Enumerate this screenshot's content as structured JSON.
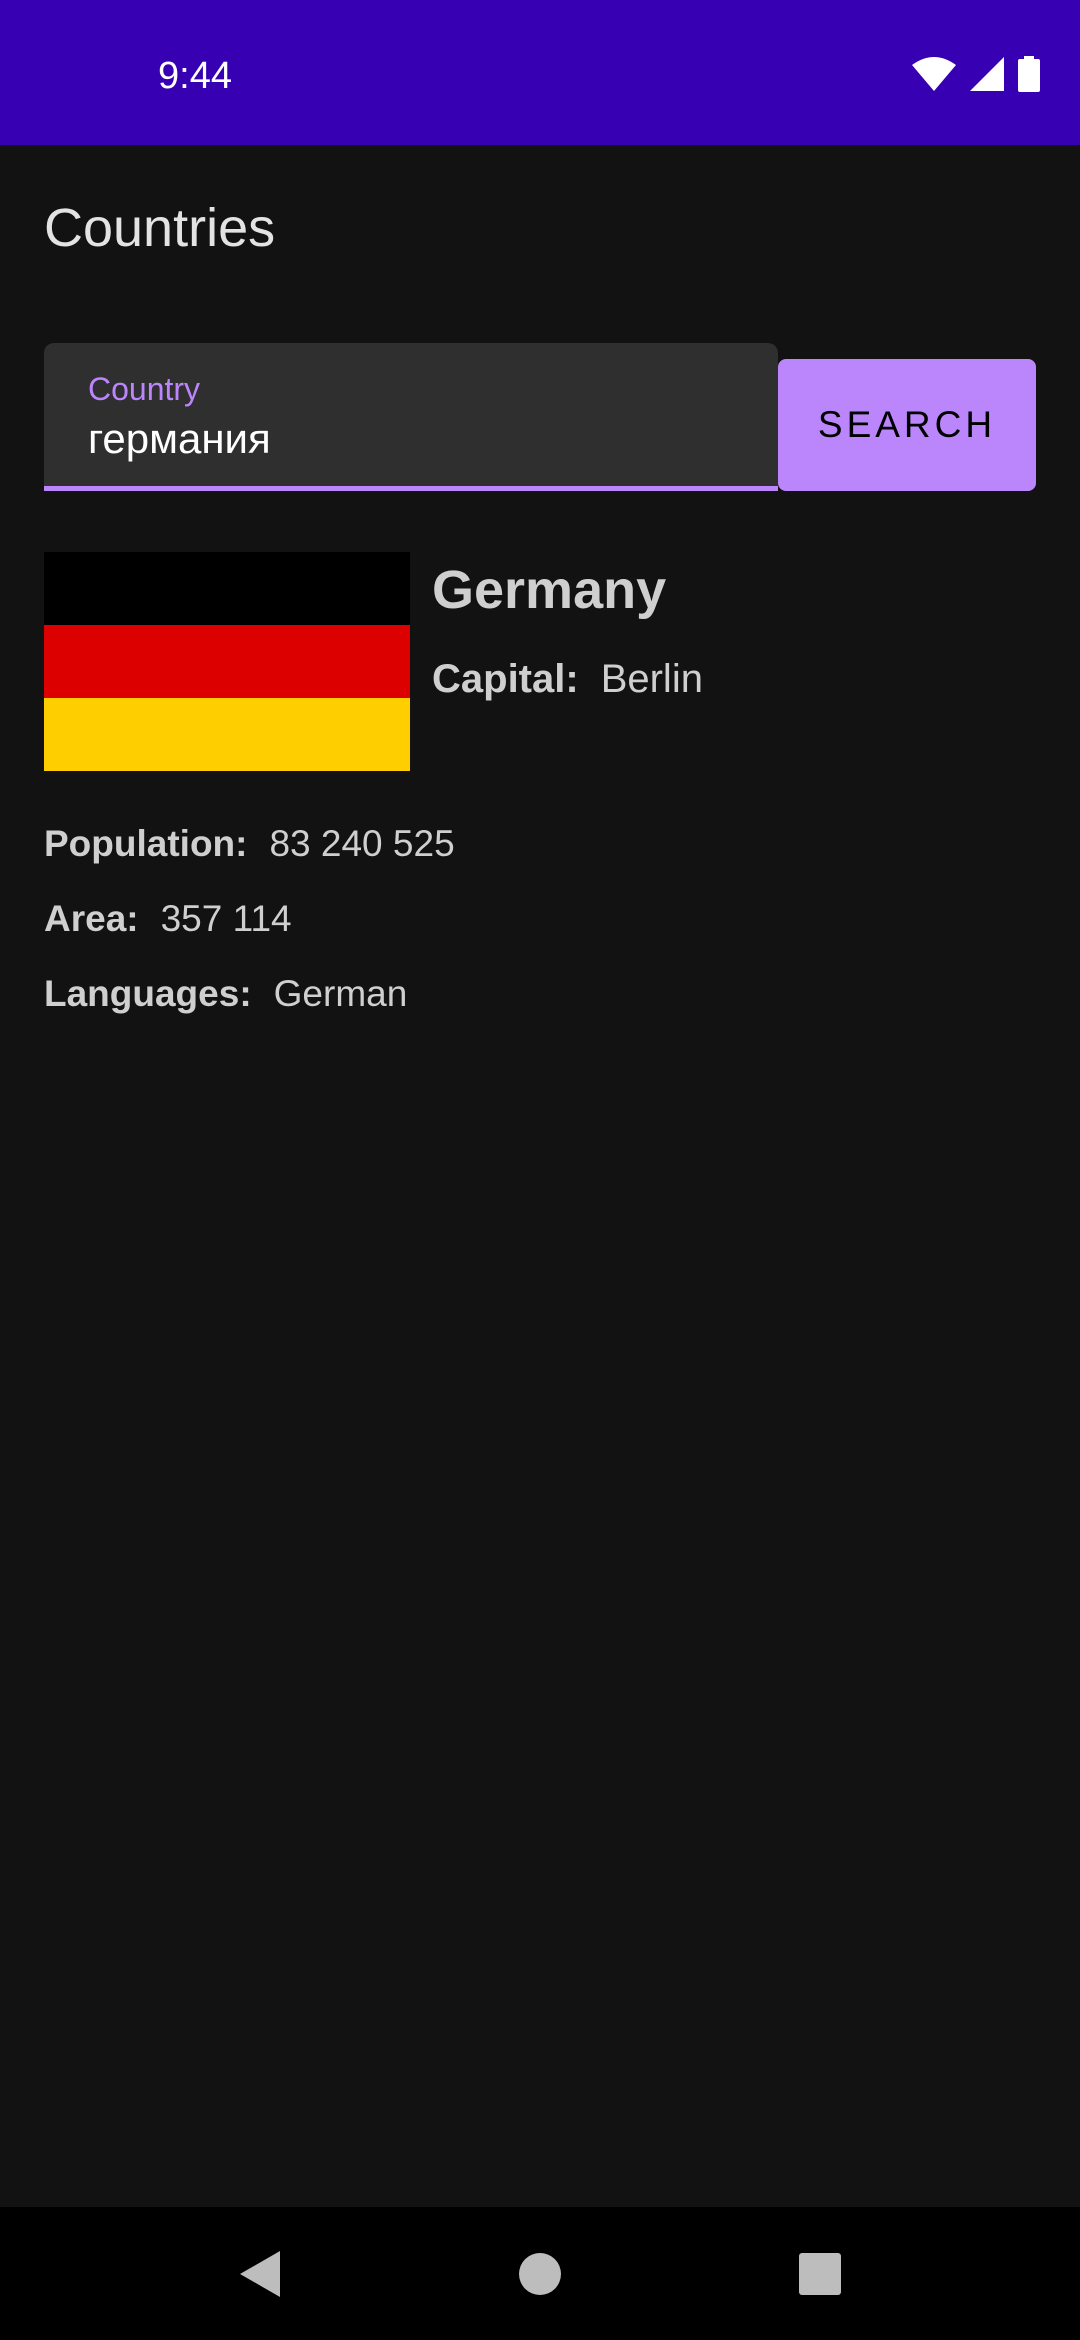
{
  "status_bar": {
    "time": "9:44",
    "icons": [
      "wifi-icon",
      "signal-icon",
      "battery-icon"
    ]
  },
  "app": {
    "title": "Countries"
  },
  "search": {
    "label": "Country",
    "value": "германия",
    "button_label": "SEARCH"
  },
  "result": {
    "country_name": "Germany",
    "flag": {
      "icon": "germany-flag-icon",
      "stripes": [
        "#000000",
        "#DD0000",
        "#FFCE00"
      ]
    },
    "capital": {
      "label": "Capital:",
      "value": "Berlin"
    },
    "population": {
      "label": "Population:",
      "value": "83 240 525"
    },
    "area": {
      "label": "Area:",
      "value": "357 114"
    },
    "languages": {
      "label": "Languages:",
      "value": "German"
    }
  },
  "nav_bar": {
    "buttons": [
      "back-icon",
      "home-icon",
      "recents-icon"
    ]
  },
  "colors": {
    "status_bar": "#3700B3",
    "accent": "#BB86FC",
    "background": "#121212"
  }
}
